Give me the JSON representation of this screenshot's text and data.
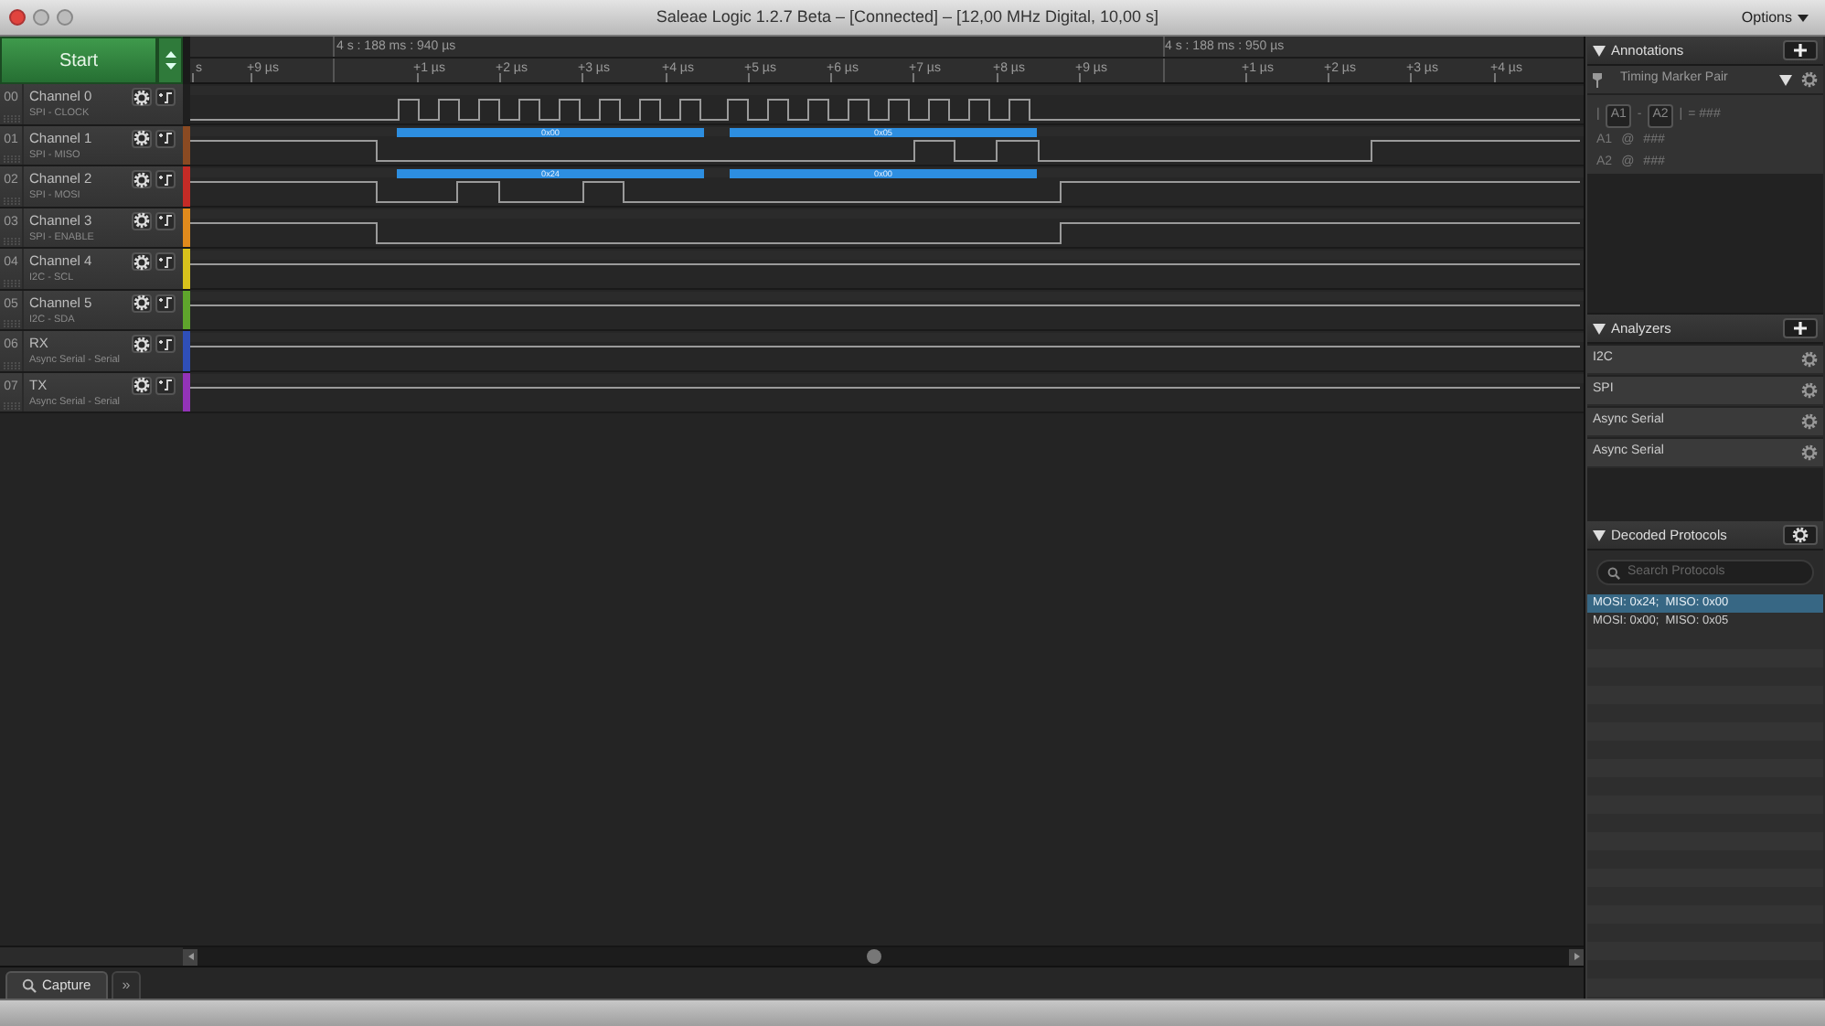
{
  "window": {
    "title": "Saleae Logic 1.2.7 Beta – [Connected] – [12,00 MHz Digital, 10,00 s]",
    "menu": "Options"
  },
  "start_button": "Start",
  "timeline": {
    "timestamps": [
      "4 s : 188 ms : 940 µs",
      "4 s : 188 ms : 950 µs"
    ],
    "ticks": [
      "s",
      "+9 µs",
      "+1 µs",
      "+2 µs",
      "+3 µs",
      "+4 µs",
      "+5 µs",
      "+6 µs",
      "+7 µs",
      "+8 µs",
      "+9 µs",
      "+1 µs",
      "+2 µs",
      "+3 µs",
      "+4 µs"
    ]
  },
  "channels": [
    {
      "number": "00",
      "name": "Channel 0",
      "protocol": "SPI - CLOCK"
    },
    {
      "number": "01",
      "name": "Channel 1",
      "protocol": "SPI - MISO",
      "color": "#8a4a22",
      "decoded": [
        "0x00",
        "0x05"
      ]
    },
    {
      "number": "02",
      "name": "Channel 2",
      "protocol": "SPI - MOSI",
      "color": "#c42b26",
      "decoded": [
        "0x24",
        "0x00"
      ]
    },
    {
      "number": "03",
      "name": "Channel 3",
      "protocol": "SPI - ENABLE",
      "color": "#e08a1c"
    },
    {
      "number": "04",
      "name": "Channel 4",
      "protocol": "I2C - SCL",
      "color": "#d8c21c"
    },
    {
      "number": "05",
      "name": "Channel 5",
      "protocol": "I2C - SDA",
      "color": "#5fa52c"
    },
    {
      "number": "06",
      "name": "RX",
      "protocol": "Async Serial - Serial",
      "color": "#2f4fb8"
    },
    {
      "number": "07",
      "name": "TX",
      "protocol": "Async Serial - Serial",
      "color": "#9333b8"
    }
  ],
  "tabs": [
    {
      "label": "Capture",
      "selected": true
    },
    {
      "label": "»",
      "selected": false
    }
  ],
  "annotations": {
    "title": "Annotations",
    "marker_pair": "Timing Marker Pair",
    "formula": {
      "open": "|",
      "a": "A1",
      "minus": "-",
      "b": "A2",
      "close": "|",
      "result": "= ###"
    },
    "markers": [
      {
        "label": "A1",
        "at": "@",
        "value": "###"
      },
      {
        "label": "A2",
        "at": "@",
        "value": "###"
      }
    ]
  },
  "analyzers": {
    "title": "Analyzers",
    "items": [
      "I2C",
      "SPI",
      "Async Serial",
      "Async Serial"
    ]
  },
  "decoded_protocols": {
    "title": "Decoded Protocols",
    "search": {
      "placeholder": "Search Protocols"
    },
    "rows": [
      {
        "text": "MOSI: 0x24;  MISO: 0x00",
        "selected": true
      },
      {
        "text": "MOSI: 0x00;  MISO: 0x05",
        "selected": false
      }
    ]
  }
}
